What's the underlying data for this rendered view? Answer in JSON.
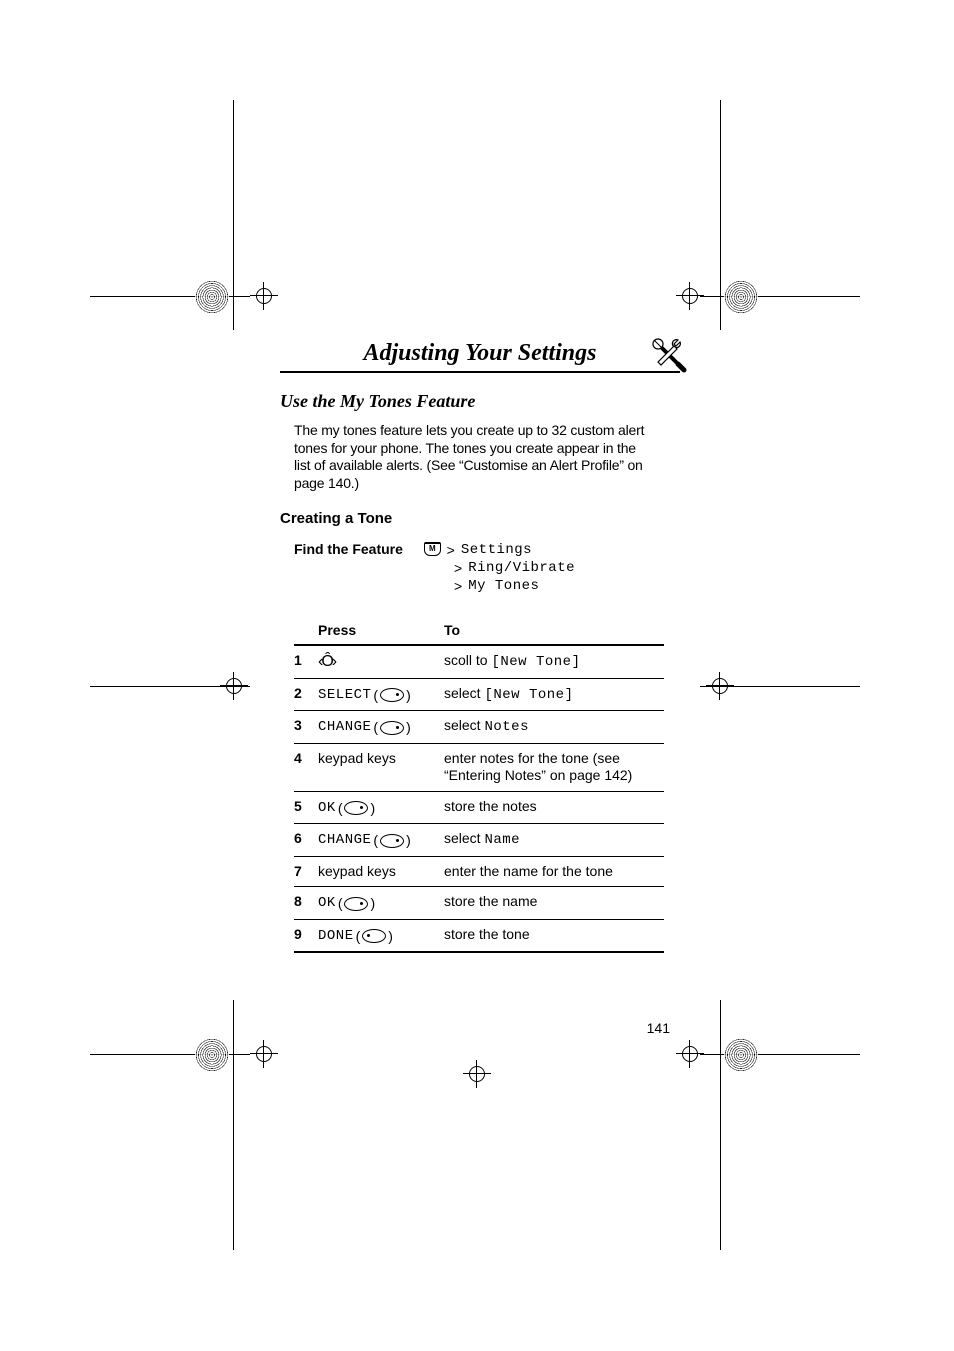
{
  "chapter_title": "Adjusting Your Settings",
  "section_title": "Use the My Tones Feature",
  "intro_text": "The my tones feature lets you create up to 32 custom alert tones for your phone. The tones you create appear in the list of available alerts. (See “Customise an Alert Profile” on page 140.)",
  "sub_title": "Creating a Tone",
  "find_label": "Find the Feature",
  "menu_key_label": "M",
  "gt": ">",
  "path": {
    "line1": "Settings",
    "line2": "Ring/Vibrate",
    "line3": "My Tones"
  },
  "table": {
    "head_col1": "",
    "head_press": "Press",
    "head_to": "To",
    "rows": [
      {
        "num": "1",
        "press_type": "nav",
        "press_label": "",
        "to_prefix": "scoll to ",
        "to_mono": "[New Tone]",
        "to_suffix": ""
      },
      {
        "num": "2",
        "press_type": "softkey-right",
        "press_label": "SELECT",
        "to_prefix": "select ",
        "to_mono": "[New Tone]",
        "to_suffix": ""
      },
      {
        "num": "3",
        "press_type": "softkey-right",
        "press_label": "CHANGE",
        "to_prefix": "select ",
        "to_mono": "Notes",
        "to_suffix": ""
      },
      {
        "num": "4",
        "press_type": "plain",
        "press_label": "keypad keys",
        "to_prefix": "enter notes for the tone (see “Entering Notes” on page 142)",
        "to_mono": "",
        "to_suffix": ""
      },
      {
        "num": "5",
        "press_type": "softkey-right",
        "press_label": "OK",
        "to_prefix": "store the notes",
        "to_mono": "",
        "to_suffix": ""
      },
      {
        "num": "6",
        "press_type": "softkey-right",
        "press_label": "CHANGE",
        "to_prefix": "select ",
        "to_mono": "Name",
        "to_suffix": ""
      },
      {
        "num": "7",
        "press_type": "plain",
        "press_label": "keypad keys",
        "to_prefix": "enter the name for the tone",
        "to_mono": "",
        "to_suffix": ""
      },
      {
        "num": "8",
        "press_type": "softkey-right",
        "press_label": "OK",
        "to_prefix": "store the name",
        "to_mono": "",
        "to_suffix": ""
      },
      {
        "num": "9",
        "press_type": "softkey-left",
        "press_label": "DONE",
        "to_prefix": "store the tone",
        "to_mono": "",
        "to_suffix": ""
      }
    ]
  },
  "page_number": "141"
}
